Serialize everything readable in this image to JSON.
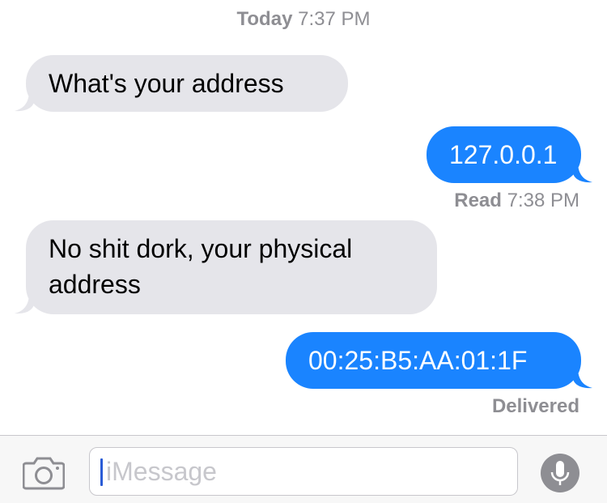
{
  "header": {
    "day": "Today",
    "time": "7:37 PM"
  },
  "messages": [
    {
      "direction": "incoming",
      "text": "What's your address"
    },
    {
      "direction": "outgoing",
      "text": "127.0.0.1"
    },
    {
      "direction": "incoming",
      "line1": "No shit dork, your physical",
      "line2": "address"
    },
    {
      "direction": "outgoing",
      "text": "00:25:B5:AA:01:1F"
    }
  ],
  "receipts": {
    "read_label": "Read",
    "read_time": "7:38 PM",
    "delivered_label": "Delivered"
  },
  "composer": {
    "placeholder": "iMessage",
    "value": "",
    "camera_icon": "camera-icon",
    "mic_icon": "microphone-icon"
  },
  "colors": {
    "outgoing_bubble": "#1a84ff",
    "incoming_bubble": "#e5e5ea",
    "meta_text": "#8e8e93"
  }
}
